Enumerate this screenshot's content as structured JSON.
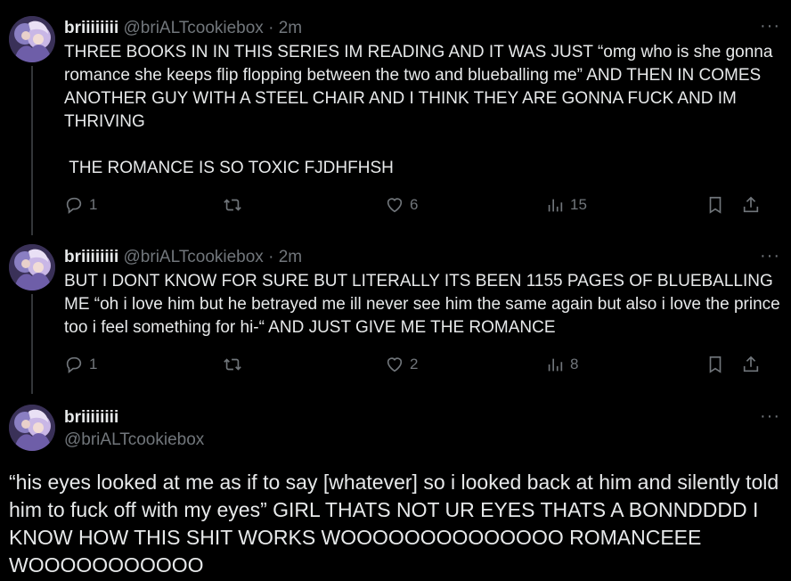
{
  "tweets": [
    {
      "name": "briiiiiiii",
      "handle": "@briALTcookiebox",
      "dot": "·",
      "time": "2m",
      "more": "···",
      "text": "THREE BOOKS IN IN THIS SERIES IM READING AND IT WAS JUST “omg who is she gonna romance she keeps flip flopping between the two and blueballing me” AND THEN IN COMES ANOTHER GUY WITH A STEEL CHAIR AND I THINK THEY ARE GONNA FUCK AND IM THRIVING\n\n THE ROMANCE IS SO TOXIC FJDHFHSH",
      "replies": "1",
      "retweets": "",
      "likes": "6",
      "views": "15"
    },
    {
      "name": "briiiiiiii",
      "handle": "@briALTcookiebox",
      "dot": "·",
      "time": "2m",
      "more": "···",
      "text": "BUT I DONT KNOW FOR SURE BUT LITERALLY ITS BEEN 1155 PAGES OF BLUEBALLING ME “oh i love him but he betrayed me ill never see him the same again but also i love the prince too i feel something for hi-“ AND JUST GIVE ME THE ROMANCE",
      "replies": "1",
      "retweets": "",
      "likes": "2",
      "views": "8"
    }
  ],
  "focus": {
    "name": "briiiiiiii",
    "handle": "@briALTcookiebox",
    "more": "···",
    "text": "“his eyes looked at me as if to say [whatever] so i looked back at him and silently told him to fuck off with my eyes” GIRL THATS NOT UR EYES THATS A BONNDDDD I KNOW HOW THIS SHIT WORKS WOOOOOOOOOOOOOO ROMANCEEE WOOOOOOOOOOO"
  },
  "icons": {
    "reply": "reply-icon",
    "retweet": "retweet-icon",
    "like": "heart-icon",
    "views": "views-icon",
    "bookmark": "bookmark-icon",
    "share": "share-icon"
  },
  "colors": {
    "background": "#000000",
    "text": "#e7e9ea",
    "muted": "#71767b",
    "line": "#333639"
  }
}
